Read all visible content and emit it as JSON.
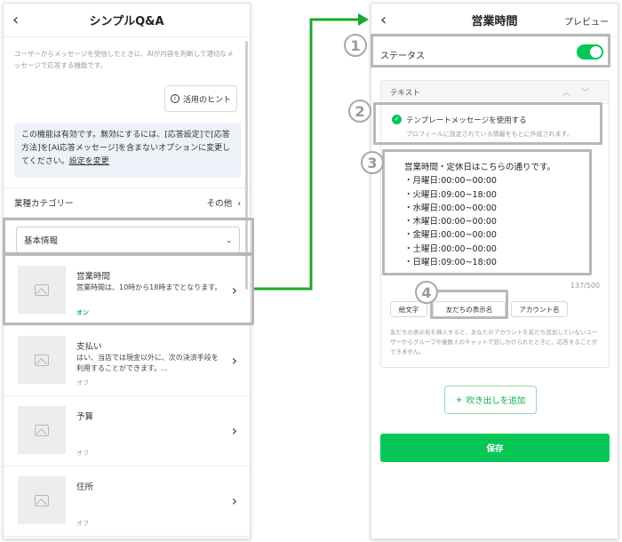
{
  "left": {
    "back_glyph": "‹",
    "title": "シンプルQ&A",
    "description": "ユーザーからメッセージを受信したときに、AIが内容を判断して適切なメッセージで応答する機能です。",
    "hint_label": "活用のヒント",
    "notice_text": "この機能は有効です。無効にするには、[応答設定]で[応答方法]を[AI応答メッセージ]を含まないオプションに変更してください。",
    "notice_link": "設定を変更",
    "category_label": "業種カテゴリー",
    "category_value": "その他",
    "select_value": "基本情報",
    "items": [
      {
        "title": "営業時間",
        "subtitle": "営業時間は、10時から18時までとなります。",
        "status": "オン"
      },
      {
        "title": "支払い",
        "subtitle": "はい、当店では現金以外に、次の決済手段を利用することができます。...",
        "status": "オフ"
      },
      {
        "title": "予算",
        "subtitle": "",
        "status": "オフ"
      },
      {
        "title": "住所",
        "subtitle": "",
        "status": "オフ"
      }
    ]
  },
  "right": {
    "back_glyph": "‹",
    "title": "営業時間",
    "preview_label": "プレビュー",
    "status_label": "ステータス",
    "status_on": true,
    "card_header": "テキスト",
    "template_label": "テンプレートメッセージを使用する",
    "template_sub": "プロフィールに設定されている情報をもとに作成されます。",
    "message_lines": [
      "営業時間・定休日はこちらの通りです。",
      "・月曜日:00:00~00:00",
      "・火曜日:09:00~18:00",
      "・水曜日:00:00~00:00",
      "・木曜日:00:00~00:00",
      "・金曜日:00:00~00:00",
      "・土曜日:00:00~00:00",
      "・日曜日:09:00~18:00"
    ],
    "char_count": "137/500",
    "chips": [
      "絵文字",
      "友だちの表示名",
      "アカウント名"
    ],
    "help_text": "友だちの表示名を挿入すると、あなたのアカウントを友だち追加していないユーザーからグループや複数人のチャットで話しかけられたときに、応答することができません。",
    "add_label": "吹き出しを追加",
    "save_label": "保存"
  },
  "annotations": [
    "1",
    "2",
    "3",
    "4"
  ],
  "colors": {
    "accent": "#06c755",
    "connector": "#1aa82a",
    "highlight": "#b8b8b8"
  }
}
